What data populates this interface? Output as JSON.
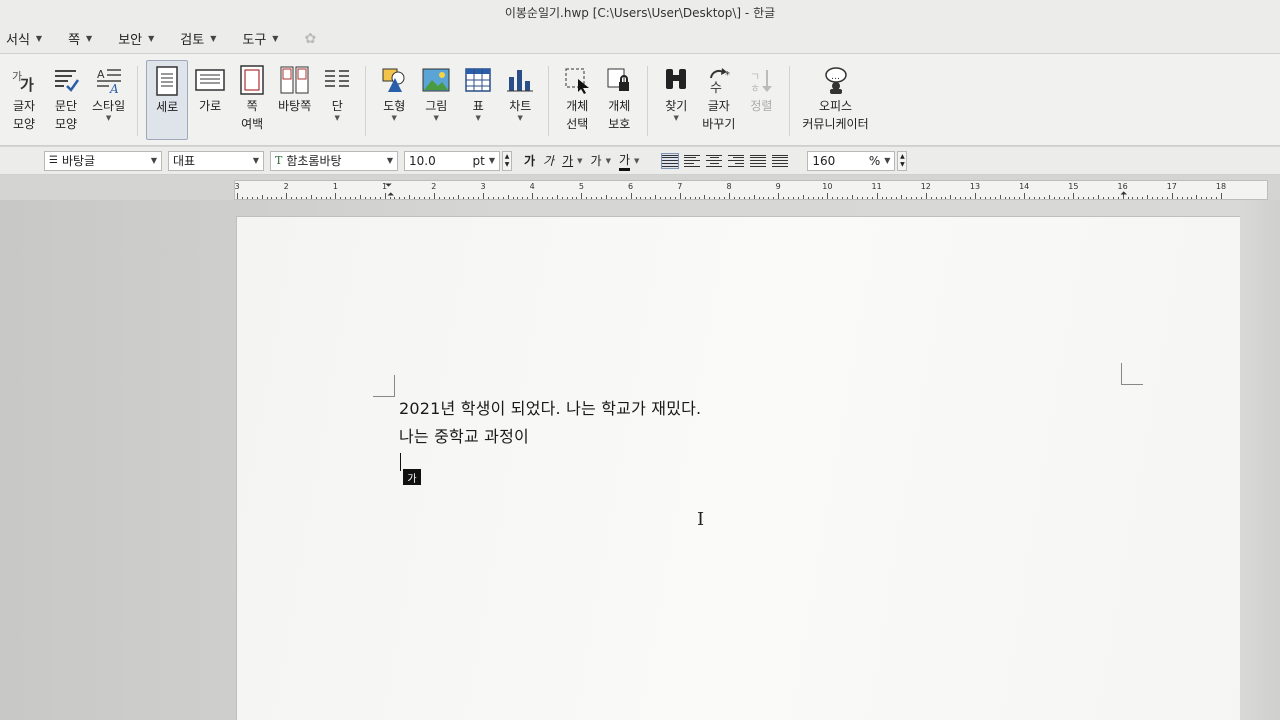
{
  "window": {
    "title": "이봉순일기.hwp [C:\\Users\\User\\Desktop\\] - 한글"
  },
  "menu": [
    {
      "label": "서식"
    },
    {
      "label": "쪽"
    },
    {
      "label": "보안"
    },
    {
      "label": "검토"
    },
    {
      "label": "도구"
    }
  ],
  "ribbon": {
    "char_shape": {
      "line1": "글자",
      "line2": "모양"
    },
    "para_shape": {
      "line1": "문단",
      "line2": "모양"
    },
    "style": {
      "line1": "스타일"
    },
    "vertical": {
      "line1": "세로"
    },
    "horizontal": {
      "line1": "가로"
    },
    "page_margin": {
      "line1": "쪽",
      "line2": "여백"
    },
    "background": {
      "line1": "바탕쪽"
    },
    "column": {
      "line1": "단"
    },
    "shape": {
      "line1": "도형"
    },
    "picture": {
      "line1": "그림"
    },
    "table": {
      "line1": "표"
    },
    "chart": {
      "line1": "차트"
    },
    "obj_select": {
      "line1": "개체",
      "line2": "선택"
    },
    "obj_protect": {
      "line1": "개체",
      "line2": "보호"
    },
    "find": {
      "line1": "찾기"
    },
    "replace": {
      "line1": "글자",
      "line2": "바꾸기"
    },
    "sort": {
      "line1": "정렬"
    },
    "office": {
      "line1": "오피스",
      "line2": "커뮤니케이터"
    }
  },
  "format": {
    "style_name": "바탕글",
    "lang": "대표",
    "font": "함초롬바탕",
    "font_prefix": "T",
    "size": "10.0",
    "unit": "pt",
    "bold": "가",
    "italic": "가",
    "underline": "가",
    "strike": "가",
    "sup": "가",
    "color": "가",
    "line_spacing": "160",
    "pct": "%"
  },
  "ruler": {
    "numbers": [
      "3",
      "2",
      "1",
      "1",
      "2",
      "3",
      "4",
      "5",
      "6",
      "7",
      "8",
      "9",
      "10",
      "11",
      "12",
      "13",
      "14",
      "15",
      "16",
      "17",
      "18"
    ]
  },
  "document": {
    "line1": "2021년 학생이 되었다. 나는 학교가 재밌다.",
    "line2": "나는 중학교 과정이"
  },
  "ime": {
    "badge": "가"
  }
}
